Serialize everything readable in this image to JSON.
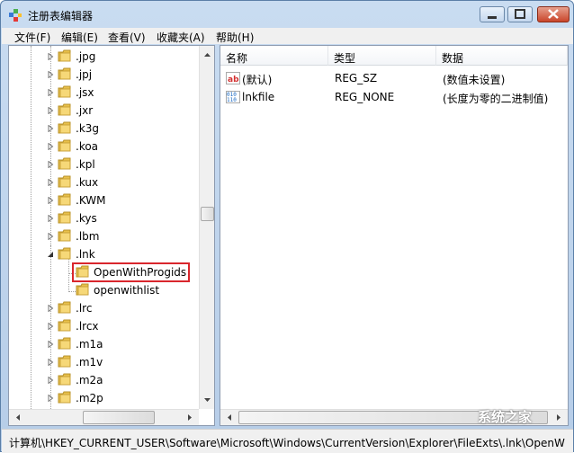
{
  "window": {
    "title": "注册表编辑器",
    "icon": "regedit-icon"
  },
  "menu": [
    "文件(F)",
    "编辑(E)",
    "查看(V)",
    "收藏夹(A)",
    "帮助(H)"
  ],
  "tree": [
    {
      "label": ".jpg",
      "expanded": false
    },
    {
      "label": ".jpj",
      "expanded": false
    },
    {
      "label": ".jsx",
      "expanded": false
    },
    {
      "label": ".jxr",
      "expanded": false
    },
    {
      "label": ".k3g",
      "expanded": false
    },
    {
      "label": ".koa",
      "expanded": false
    },
    {
      "label": ".kpl",
      "expanded": false
    },
    {
      "label": ".kux",
      "expanded": false
    },
    {
      "label": ".KWM",
      "expanded": false
    },
    {
      "label": ".kys",
      "expanded": false
    },
    {
      "label": ".lbm",
      "expanded": false
    },
    {
      "label": ".lnk",
      "expanded": true
    },
    {
      "label": "OpenWithProgids",
      "child": true,
      "selected": true
    },
    {
      "label": "openwithlist",
      "child": true
    },
    {
      "label": ".lrc",
      "expanded": false
    },
    {
      "label": ".lrcx",
      "expanded": false
    },
    {
      "label": ".m1a",
      "expanded": false
    },
    {
      "label": ".m1v",
      "expanded": false
    },
    {
      "label": ".m2a",
      "expanded": false
    },
    {
      "label": ".m2p",
      "expanded": false
    }
  ],
  "columns": [
    "名称",
    "类型",
    "数据"
  ],
  "values": [
    {
      "icon": "string-value-icon",
      "name": "(默认)",
      "type": "REG_SZ",
      "data": "(数值未设置)"
    },
    {
      "icon": "binary-value-icon",
      "name": "lnkfile",
      "type": "REG_NONE",
      "data": "(长度为零的二进制值)"
    }
  ],
  "status": "计算机\\HKEY_CURRENT_USER\\Software\\Microsoft\\Windows\\CurrentVersion\\Explorer\\FileExts\\.lnk\\OpenW",
  "watermark": "系统之家",
  "colors": {
    "highlight": "#d9262c",
    "folder": "#e8c04a"
  }
}
